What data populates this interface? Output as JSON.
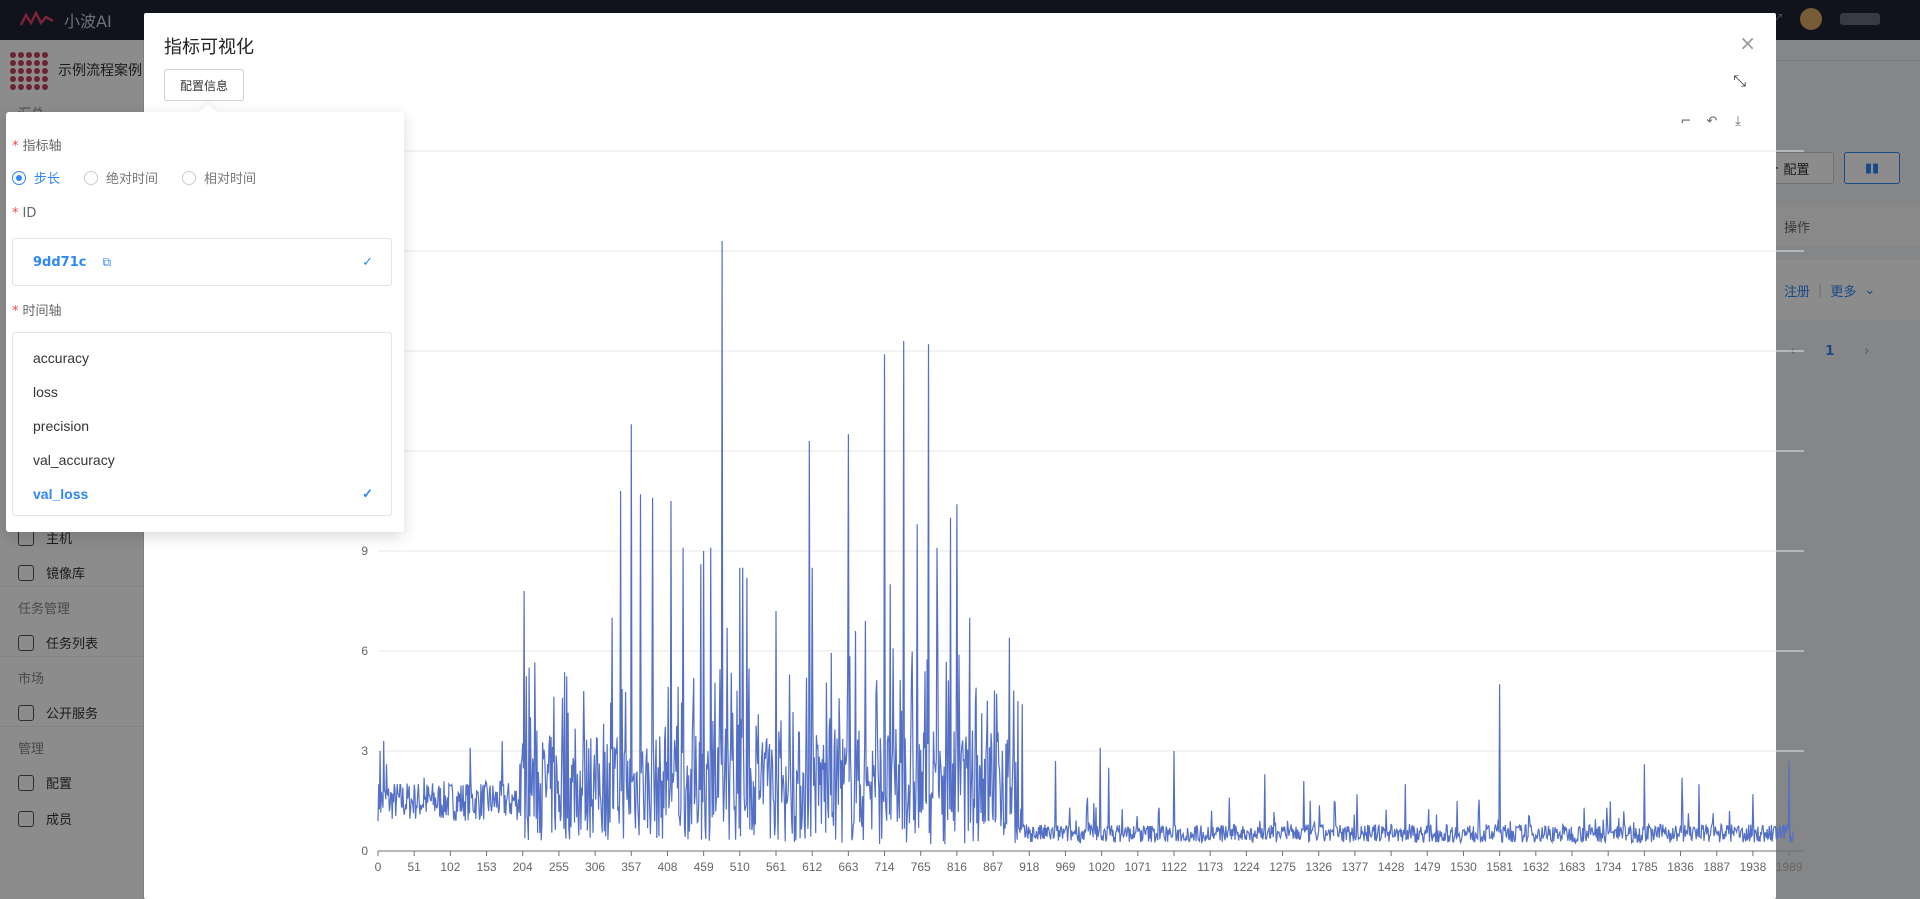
{
  "app": {
    "name": "小波AI"
  },
  "sidebar": {
    "project_name": "示例流程案例",
    "partial_top_section": "汇总",
    "items": [
      {
        "label": "主机",
        "icon": "server-icon"
      },
      {
        "label": "镜像库",
        "icon": "database-icon"
      },
      {
        "section": "任务管理"
      },
      {
        "label": "任务列表",
        "icon": "share-nodes-icon"
      },
      {
        "section": "市场"
      },
      {
        "label": "公开服务",
        "icon": "shop-icon"
      },
      {
        "section": "管理"
      },
      {
        "label": "配置",
        "icon": "gear-icon"
      },
      {
        "label": "成员",
        "icon": "users-icon"
      }
    ]
  },
  "background_page": {
    "config_button": "配置",
    "table_header_ops": "操作",
    "row_actions": {
      "register": "注册",
      "separator": "|",
      "more": "更多"
    },
    "pager": {
      "current": "1"
    }
  },
  "modal": {
    "title": "指标可视化",
    "config_button": "配置信息"
  },
  "popover": {
    "metric_axis_label": "指标轴",
    "axis_options": [
      "步长",
      "绝对时间",
      "相对时间"
    ],
    "axis_selected": "步长",
    "id_label": "ID",
    "id_value": "9dd71c",
    "time_axis_label": "时间轴",
    "metrics": [
      "accuracy",
      "loss",
      "precision",
      "val_accuracy",
      "val_loss"
    ],
    "metric_selected": "val_loss"
  },
  "chart_data": {
    "type": "line",
    "series": [
      {
        "name": "val_loss",
        "color": "#5470c6"
      }
    ],
    "x_ticks": [
      "0",
      "51",
      "102",
      "153",
      "204",
      "255",
      "306",
      "357",
      "408",
      "459",
      "510",
      "561",
      "612",
      "663",
      "714",
      "765",
      "816",
      "867",
      "918",
      "969",
      "1020",
      "1071",
      "1122",
      "1173",
      "1224",
      "1275",
      "1326",
      "1377",
      "1428",
      "1479",
      "1530",
      "1581",
      "1632",
      "1683",
      "1734",
      "1785",
      "1836",
      "1887",
      "1938",
      "1989"
    ],
    "y_ticks": [
      "0",
      "3",
      "6",
      "9"
    ],
    "xlim": [
      0,
      2010
    ],
    "ylim": [
      0,
      21
    ],
    "grid": true,
    "peaks": [
      [
        3,
        3.0
      ],
      [
        8,
        3.3
      ],
      [
        12,
        2.6
      ],
      [
        52,
        1.8
      ],
      [
        65,
        2.2
      ],
      [
        130,
        3.1
      ],
      [
        175,
        3.3
      ],
      [
        206,
        7.8
      ],
      [
        260,
        4.6
      ],
      [
        290,
        4.8
      ],
      [
        330,
        7.0
      ],
      [
        342,
        10.8
      ],
      [
        357,
        12.8
      ],
      [
        370,
        10.7
      ],
      [
        387,
        10.6
      ],
      [
        413,
        10.5
      ],
      [
        430,
        9.1
      ],
      [
        455,
        8.6
      ],
      [
        459,
        9.0
      ],
      [
        469,
        9.1
      ],
      [
        485,
        18.3
      ],
      [
        492,
        6.7
      ],
      [
        510,
        8.5
      ],
      [
        514,
        8.5
      ],
      [
        520,
        8.2
      ],
      [
        561,
        7.2
      ],
      [
        608,
        12.3
      ],
      [
        612,
        8.5
      ],
      [
        663,
        12.5
      ],
      [
        673,
        6.6
      ],
      [
        687,
        6.9
      ],
      [
        714,
        14.9
      ],
      [
        722,
        8.0
      ],
      [
        741,
        15.3
      ],
      [
        760,
        9.8
      ],
      [
        776,
        15.2
      ],
      [
        788,
        9.1
      ],
      [
        807,
        10.0
      ],
      [
        816,
        10.4
      ],
      [
        834,
        7.0
      ],
      [
        880,
        3.0
      ],
      [
        890,
        6.4
      ],
      [
        902,
        4.5
      ],
      [
        908,
        4.4
      ],
      [
        955,
        2.7
      ],
      [
        975,
        1.3
      ],
      [
        1000,
        1.6
      ],
      [
        1018,
        3.1
      ],
      [
        1030,
        2.5
      ],
      [
        1101,
        1.3
      ],
      [
        1122,
        3.0
      ],
      [
        1200,
        1.6
      ],
      [
        1250,
        2.3
      ],
      [
        1305,
        2.1
      ],
      [
        1348,
        1.5
      ],
      [
        1380,
        1.7
      ],
      [
        1448,
        2.0
      ],
      [
        1521,
        1.5
      ],
      [
        1551,
        1.2
      ],
      [
        1581,
        5.0
      ],
      [
        1700,
        1.3
      ],
      [
        1732,
        1.3
      ],
      [
        1785,
        2.6
      ],
      [
        1838,
        2.2
      ],
      [
        1862,
        2.0
      ],
      [
        1905,
        1.2
      ],
      [
        1938,
        1.7
      ],
      [
        1989,
        2.7
      ]
    ]
  }
}
